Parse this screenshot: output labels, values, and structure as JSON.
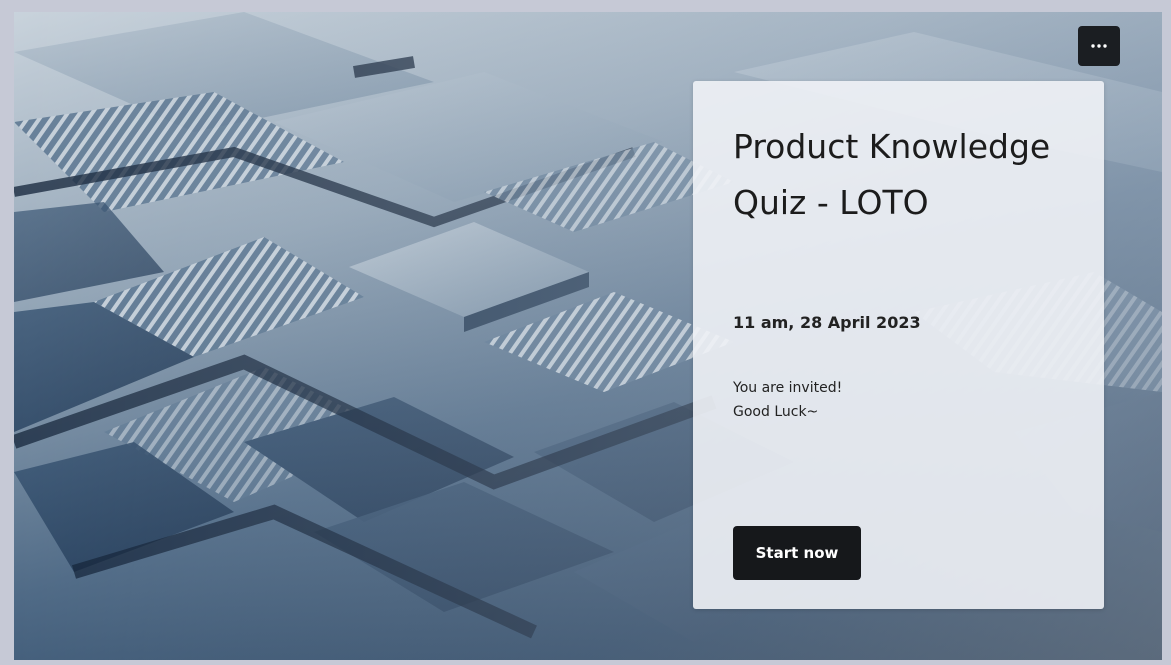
{
  "quiz": {
    "title": "Product Knowledge Quiz - LOTO",
    "datetime": "11 am, 28 April 2023",
    "message_lines": [
      "You are invited!",
      "Good Luck~"
    ],
    "start_label": "Start now"
  },
  "toolbar": {
    "more_icon": "more-horizontal-icon"
  },
  "colors": {
    "button_bg": "#16181b",
    "card_bg": "#f0f2f6",
    "background_dark": "#14283f",
    "background_light": "#c9d3dc"
  }
}
